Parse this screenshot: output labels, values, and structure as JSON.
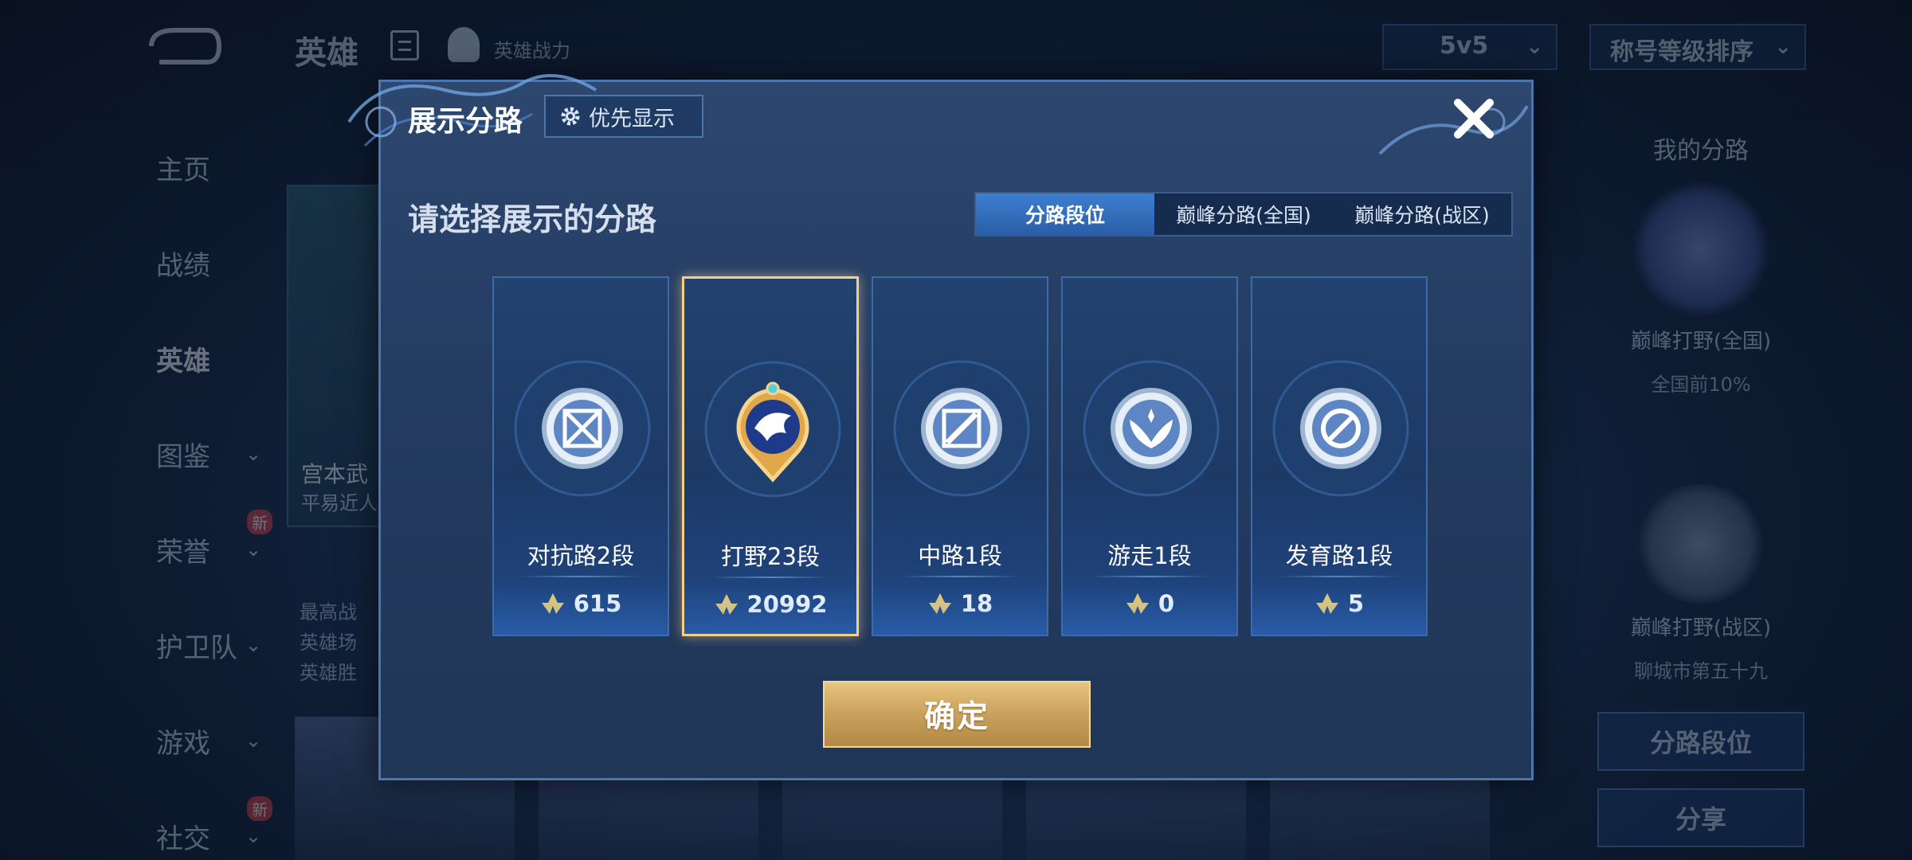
{
  "background": {
    "title": "英雄",
    "power_label": "英雄战力",
    "mode_select": "5v5",
    "sort_select": "称号等级排序",
    "nav": [
      {
        "label": "主页",
        "has_chevron": false,
        "is_new": false
      },
      {
        "label": "战绩",
        "has_chevron": false,
        "is_new": false
      },
      {
        "label": "英雄",
        "has_chevron": false,
        "is_new": false,
        "active": true
      },
      {
        "label": "图鉴",
        "has_chevron": true,
        "is_new": false
      },
      {
        "label": "荣誉",
        "has_chevron": true,
        "is_new": true
      },
      {
        "label": "护卫队",
        "has_chevron": true,
        "is_new": false
      },
      {
        "label": "游戏",
        "has_chevron": true,
        "is_new": false
      },
      {
        "label": "社交",
        "has_chevron": true,
        "is_new": true
      }
    ],
    "new_badge": "新",
    "hero_card": {
      "name": "宫本武",
      "subtitle": "平易近人"
    },
    "hero_stats": [
      "最高战",
      "英雄场",
      "英雄胜"
    ],
    "right_panel": {
      "title": "我的分路",
      "rank1": "巅峰打野(全国)",
      "rank1_sub": "全国前10%",
      "rank2": "巅峰打野(战区)",
      "rank2_sub": "聊城市第五十九",
      "btn1": "分路段位",
      "btn2": "分享"
    }
  },
  "dialog": {
    "title": "展示分路",
    "priority_button": "优先显示",
    "prompt": "请选择展示的分路",
    "tabs": [
      {
        "label": "分路段位",
        "active": true
      },
      {
        "label": "巅峰分路(全国)",
        "active": false
      },
      {
        "label": "巅峰分路(战区)",
        "active": false
      }
    ],
    "cards": [
      {
        "name": "对抗路2段",
        "score": "615",
        "selected": false,
        "icon": "sword-shield-icon"
      },
      {
        "name": "打野23段",
        "score": "20992",
        "selected": true,
        "icon": "dragon-icon"
      },
      {
        "name": "中路1段",
        "score": "18",
        "selected": false,
        "icon": "staff-icon"
      },
      {
        "name": "游走1段",
        "score": "0",
        "selected": false,
        "icon": "wings-icon"
      },
      {
        "name": "发育路1段",
        "score": "5",
        "selected": false,
        "icon": "arrow-target-icon"
      }
    ],
    "confirm_button": "确定"
  },
  "colors": {
    "selected_border": "#f2d08a",
    "confirm_gold": "#c9a15c",
    "active_tab": "#3e7fd0"
  }
}
